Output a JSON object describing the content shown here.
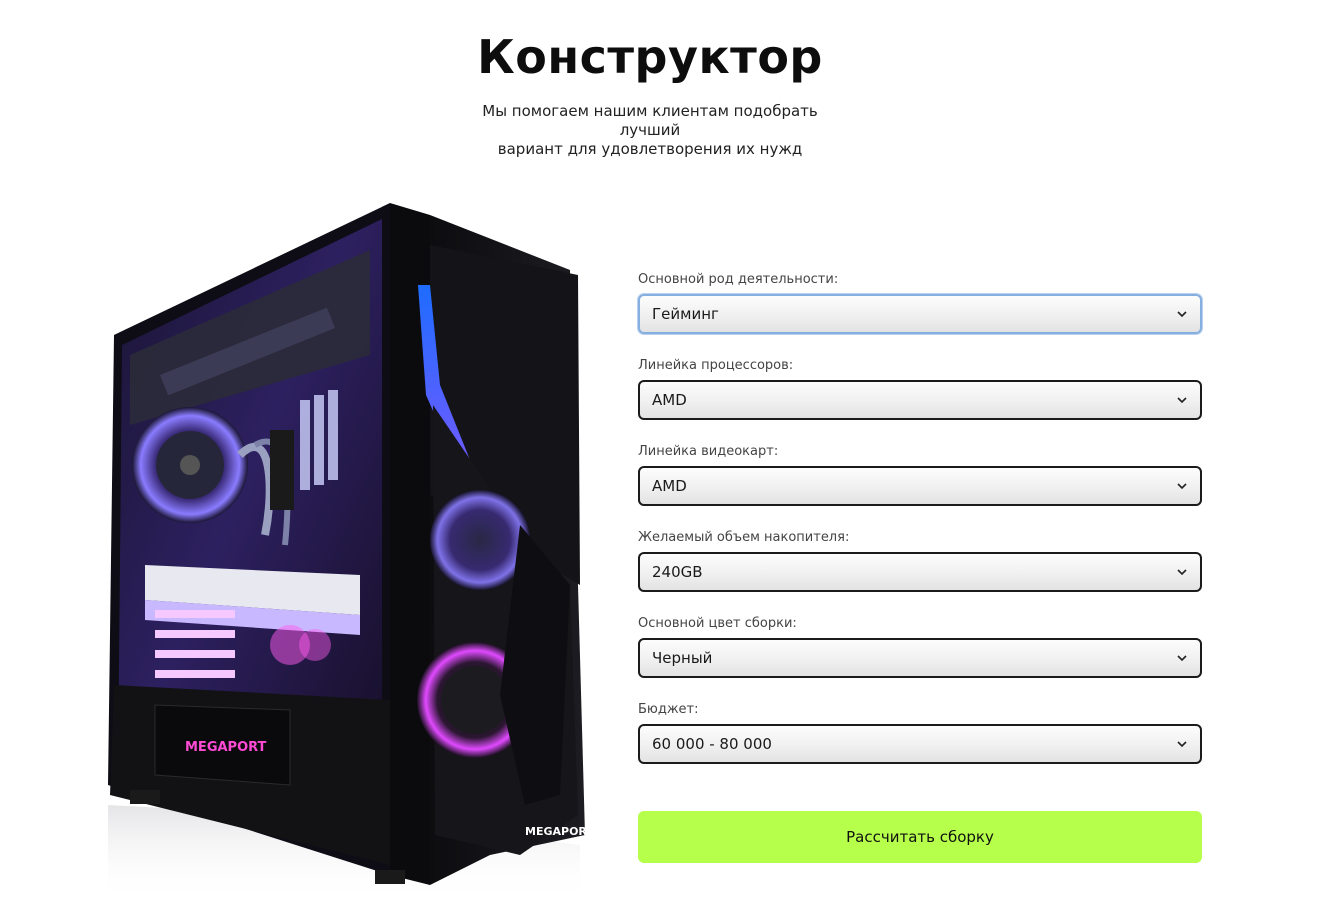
{
  "header": {
    "title": "Конструктор",
    "subtitle_line1": "Мы помогаем нашим клиентам подобрать лучший",
    "subtitle_line2": "вариант для удовлетворения их нужд"
  },
  "image": {
    "brand_text": "MEGAPORT"
  },
  "form": {
    "fields": [
      {
        "label": "Основной род деятельности:",
        "value": "Гейминг"
      },
      {
        "label": "Линейка процессоров:",
        "value": "AMD"
      },
      {
        "label": "Линейка видеокарт:",
        "value": "AMD"
      },
      {
        "label": "Желаемый объем накопителя:",
        "value": "240GB"
      },
      {
        "label": "Основной цвет сборки:",
        "value": "Черный"
      },
      {
        "label": "Бюджет:",
        "value": "60 000 - 80 000"
      }
    ],
    "submit_label": "Рассчитать сборку"
  },
  "colors": {
    "accent": "#b6ff4a",
    "focus": "#86aede",
    "border": "#1b1b1b"
  },
  "icons": {
    "select_arrow": "chevron-down-icon"
  }
}
